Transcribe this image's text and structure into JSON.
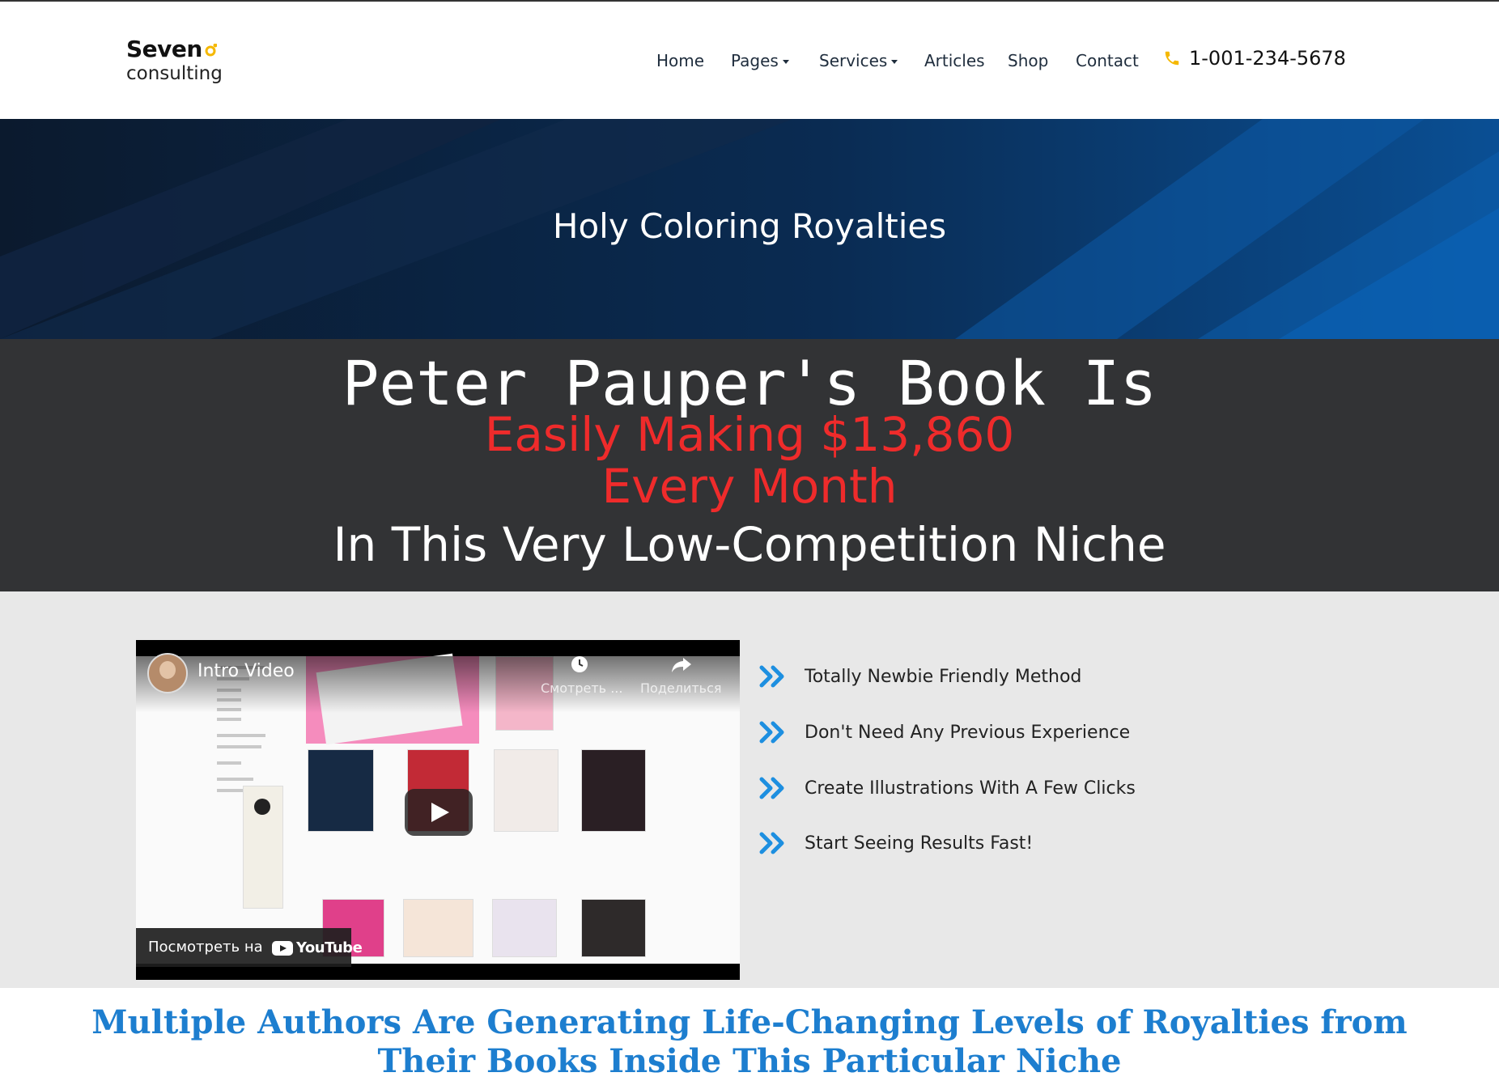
{
  "brand": {
    "name_top": "Seven",
    "name_bottom": "consulting",
    "accent": "#f5b800"
  },
  "nav": {
    "items": [
      {
        "label": "Home"
      },
      {
        "label": "Pages"
      },
      {
        "label": "Services"
      },
      {
        "label": "Articles"
      },
      {
        "label": "Shop"
      },
      {
        "label": "Contact"
      }
    ],
    "phone": "1-001-234-5678"
  },
  "hero": {
    "title": "Holy Coloring Royalties"
  },
  "headline": {
    "line1": "Peter Pauper's Book Is",
    "line2": "Easily Making $13,860",
    "line3": "Every Month",
    "line4": "In This Very Low-Competition Niche",
    "highlight_color": "#ef2b2b"
  },
  "video": {
    "title": "Intro Video",
    "watch_later": "Смотреть ...",
    "share": "Поделиться",
    "watch_on": "Посмотреть на",
    "platform": "YouTube"
  },
  "features": [
    {
      "label": "Totally Newbie Friendly Method",
      "icon": "double-chevron-right-icon"
    },
    {
      "label": "Don't Need Any Previous Experience",
      "icon": "double-chevron-right-icon"
    },
    {
      "label": "Create Illustrations With A Few Clicks",
      "icon": "double-chevron-right-icon"
    },
    {
      "label": "Start Seeing Results Fast!",
      "icon": "double-chevron-right-icon"
    }
  ],
  "bottom": {
    "title": "Multiple Authors Are Generating Life-Changing Levels of Royalties from Their Books Inside This Particular Niche",
    "color": "#1d7ecf"
  }
}
